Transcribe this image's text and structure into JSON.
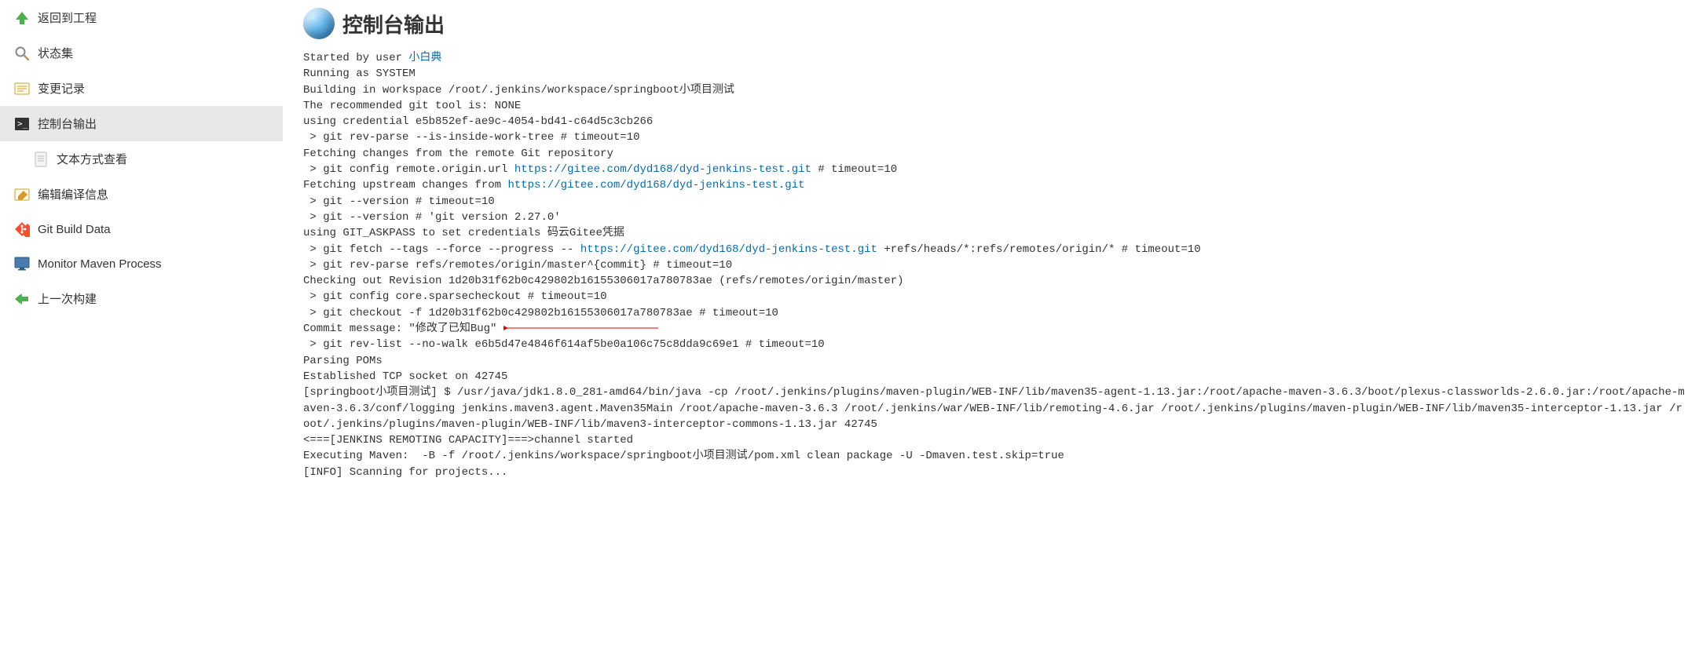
{
  "sidebar": {
    "items": [
      {
        "label": "返回到工程",
        "icon": "up-arrow"
      },
      {
        "label": "状态集",
        "icon": "search"
      },
      {
        "label": "变更记录",
        "icon": "changes"
      },
      {
        "label": "控制台输出",
        "icon": "terminal"
      },
      {
        "label": "文本方式查看",
        "icon": "document",
        "sub": true
      },
      {
        "label": "编辑编译信息",
        "icon": "edit"
      },
      {
        "label": "Git Build Data",
        "icon": "git"
      },
      {
        "label": "Monitor Maven Process",
        "icon": "monitor"
      },
      {
        "label": "上一次构建",
        "icon": "left-arrow"
      }
    ],
    "active_index": 3
  },
  "title": "控制台输出",
  "console": {
    "started_prefix": "Started by user ",
    "started_user": "小白典",
    "running": "Running as SYSTEM",
    "building": "Building in workspace /root/.jenkins/workspace/springboot小项目测试",
    "recommended": "The recommended git tool is: NONE",
    "credential": "using credential e5b852ef-ae9c-4054-bd41-c64d5c3cb266",
    "rev_parse": " > git rev-parse --is-inside-work-tree # timeout=10",
    "fetching": "Fetching changes from the remote Git repository",
    "config_prefix": " > git config remote.origin.url ",
    "config_url": "https://gitee.com/dyd168/dyd-jenkins-test.git",
    "config_suffix": " # timeout=10",
    "upstream_prefix": "Fetching upstream changes from ",
    "upstream_url": "https://gitee.com/dyd168/dyd-jenkins-test.git",
    "ver1": " > git --version # timeout=10",
    "ver2": " > git --version # 'git version 2.27.0'",
    "askpass": "using GIT_ASKPASS to set credentials 码云Gitee凭据",
    "fetch_prefix": " > git fetch --tags --force --progress -- ",
    "fetch_url": "https://gitee.com/dyd168/dyd-jenkins-test.git",
    "fetch_suffix": " +refs/heads/*:refs/remotes/origin/* # timeout=10",
    "rev_parse2": " > git rev-parse refs/remotes/origin/master^{commit} # timeout=10",
    "checkout_rev": "Checking out Revision 1d20b31f62b0c429802b16155306017a780783ae (refs/remotes/origin/master)",
    "sparse": " > git config core.sparsecheckout # timeout=10",
    "checkout_f": " > git checkout -f 1d20b31f62b0c429802b16155306017a780783ae # timeout=10",
    "commit_msg": "Commit message: \"修改了已知Bug\"",
    "rev_list": " > git rev-list --no-walk e6b5d47e4846f614af5be0a106c75c8dda9c69e1 # timeout=10",
    "parsing": "Parsing POMs",
    "tcp": "Established TCP socket on 42745",
    "java_cmd": "[springboot小项目测试] $ /usr/java/jdk1.8.0_281-amd64/bin/java -cp /root/.jenkins/plugins/maven-plugin/WEB-INF/lib/maven35-agent-1.13.jar:/root/apache-maven-3.6.3/boot/plexus-classworlds-2.6.0.jar:/root/apache-maven-3.6.3/conf/logging jenkins.maven3.agent.Maven35Main /root/apache-maven-3.6.3 /root/.jenkins/war/WEB-INF/lib/remoting-4.6.jar /root/.jenkins/plugins/maven-plugin/WEB-INF/lib/maven35-interceptor-1.13.jar /root/.jenkins/plugins/maven-plugin/WEB-INF/lib/maven3-interceptor-commons-1.13.jar 42745",
    "channel": "<===[JENKINS REMOTING CAPACITY]===>channel started",
    "exec_maven": "Executing Maven:  -B -f /root/.jenkins/workspace/springboot小项目测试/pom.xml clean package -U -Dmaven.test.skip=true",
    "scanning": "[INFO] Scanning for projects..."
  }
}
